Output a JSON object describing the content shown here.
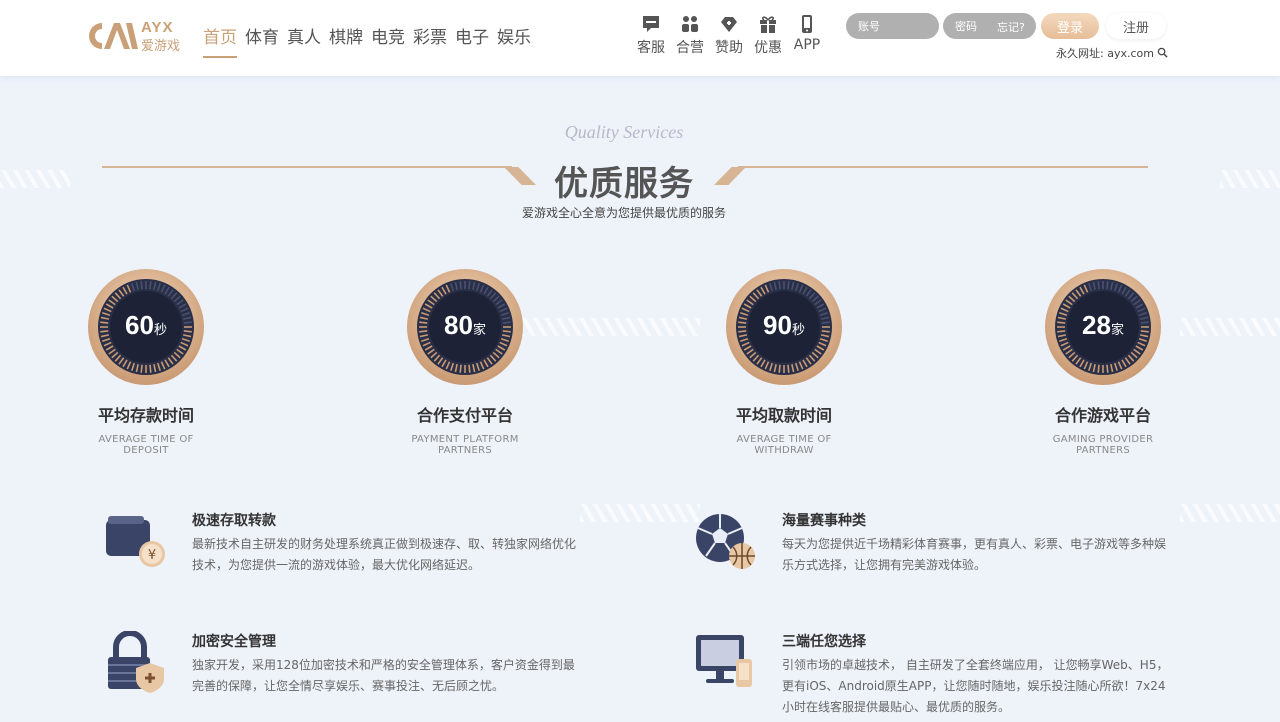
{
  "brand": {
    "logo_en": "AYX",
    "logo_cn": "爱游戏"
  },
  "nav": {
    "items": [
      {
        "label": "首页",
        "active": true
      },
      {
        "label": "体育"
      },
      {
        "label": "真人"
      },
      {
        "label": "棋牌"
      },
      {
        "label": "电竞"
      },
      {
        "label": "彩票"
      },
      {
        "label": "电子"
      },
      {
        "label": "娱乐"
      }
    ]
  },
  "quick": [
    {
      "label": "客服",
      "icon": "chat-icon"
    },
    {
      "label": "合营",
      "icon": "partner-icon"
    },
    {
      "label": "赞助",
      "icon": "sponsor-icon"
    },
    {
      "label": "优惠",
      "icon": "gift-icon"
    },
    {
      "label": "APP",
      "icon": "phone-icon"
    }
  ],
  "login": {
    "account_placeholder": "账号",
    "password_placeholder": "密码",
    "forgot": "忘记?",
    "login_label": "登录",
    "register_label": "注册",
    "permanent_url": "永久网址: ayx.com"
  },
  "section": {
    "script_title": "Quality Services",
    "title": "优质服务",
    "subtitle": "爱游戏全心全意为您提供最优质的服务"
  },
  "stats": [
    {
      "value": "60",
      "unit": "秒",
      "title": "平均存款时间",
      "en_line1": "AVERAGE TIME OF",
      "en_line2": "DEPOSIT"
    },
    {
      "value": "80",
      "unit": "家",
      "title": "合作支付平台",
      "en_line1": "PAYMENT PLATFORM",
      "en_line2": "PARTNERS"
    },
    {
      "value": "90",
      "unit": "秒",
      "title": "平均取款时间",
      "en_line1": "AVERAGE TIME OF",
      "en_line2": "WITHDRAW"
    },
    {
      "value": "28",
      "unit": "家",
      "title": "合作游戏平台",
      "en_line1": "GAMING PROVIDER",
      "en_line2": "PARTNERS"
    }
  ],
  "features": [
    {
      "icon": "wallet-icon",
      "title": "极速存取转款",
      "desc": "最新技术自主研发的财务处理系统真正做到极速存、取、转独家网络优化技术，为您提供一流的游戏体验，最大优化网络延迟。"
    },
    {
      "icon": "sports-balls-icon",
      "title": "海量赛事种类",
      "desc": "每天为您提供近千场精彩体育赛事，更有真人、彩票、电子游戏等多种娱乐方式选择，让您拥有完美游戏体验。"
    },
    {
      "icon": "lock-shield-icon",
      "title": "加密安全管理",
      "desc": "独家开发，采用128位加密技术和严格的安全管理体系，客户资金得到最完善的保障，让您全情尽享娱乐、赛事投注、无后顾之忧。"
    },
    {
      "icon": "multi-device-icon",
      "title": "三端任您选择",
      "desc": "引领市场的卓越技术， 自主研发了全套终端应用， 让您畅享Web、H5，更有iOS、Android原生APP，让您随时随地，娱乐投注随心所欲！7x24小时在线客服提供最贴心、最优质的服务。"
    }
  ]
}
